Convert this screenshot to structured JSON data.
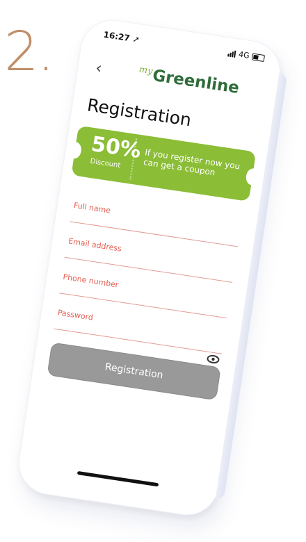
{
  "step": "2.",
  "status_bar": {
    "time": "16:27",
    "network": "4G"
  },
  "header": {
    "brand_prefix": "my",
    "brand_name": "Greenline"
  },
  "page": {
    "title": "Registration"
  },
  "coupon": {
    "percent": "50%",
    "label": "Discount",
    "text": "If you register now you can get a coupon",
    "color": "#8bbd36"
  },
  "form": {
    "fields": [
      {
        "label": "Full name"
      },
      {
        "label": "Email address"
      },
      {
        "label": "Phone number"
      },
      {
        "label": "Password"
      }
    ],
    "submit_label": "Registration"
  },
  "icons": [
    "back-chevron-icon",
    "location-arrow-icon",
    "signal-icon",
    "battery-icon",
    "eye-icon"
  ]
}
